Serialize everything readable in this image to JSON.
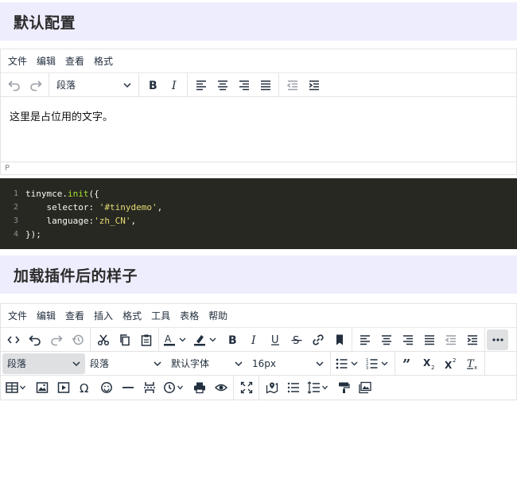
{
  "section1": {
    "title": "默认配置"
  },
  "editor1": {
    "menus": [
      "文件",
      "编辑",
      "查看",
      "格式"
    ],
    "block_select": "段落",
    "content_text": "这里是占位用的文字。",
    "status_path": "P"
  },
  "code": {
    "lines": [
      {
        "num": "1",
        "parts": [
          {
            "t": "tinymce.",
            "c": "kw"
          },
          {
            "t": "init",
            "c": "fn"
          },
          {
            "t": "({",
            "c": "kw"
          }
        ]
      },
      {
        "num": "2",
        "parts": [
          {
            "t": "    selector: ",
            "c": "kw"
          },
          {
            "t": "'#tinydemo'",
            "c": "str"
          },
          {
            "t": ",",
            "c": "kw"
          }
        ]
      },
      {
        "num": "3",
        "parts": [
          {
            "t": "    language:",
            "c": "kw"
          },
          {
            "t": "'zh_CN'",
            "c": "str"
          },
          {
            "t": ",",
            "c": "kw"
          }
        ]
      },
      {
        "num": "4",
        "parts": [
          {
            "t": "});",
            "c": "kw"
          }
        ]
      }
    ]
  },
  "section2": {
    "title": "加载插件后的样子"
  },
  "editor2": {
    "menus": [
      "文件",
      "编辑",
      "查看",
      "插入",
      "格式",
      "工具",
      "表格",
      "帮助"
    ],
    "block_select": "段落",
    "style_select": "段落",
    "font_select": "默认字体",
    "size_select": "16px"
  },
  "colors": {
    "accent_bg": "#eeedfd",
    "code_bg": "#272822",
    "text": "#222f3e"
  }
}
